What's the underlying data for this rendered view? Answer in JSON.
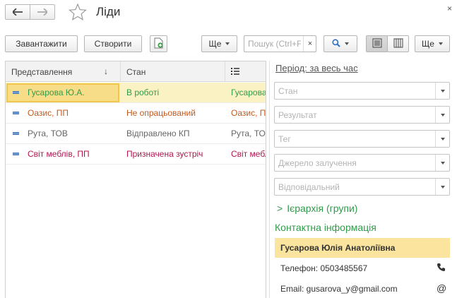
{
  "window": {
    "title": "Ліди",
    "close_glyph": "×"
  },
  "toolbar": {
    "load_label": "Завантажити",
    "create_label": "Створити",
    "more_label": "Ще",
    "search_placeholder": "Пошук (Ctrl+F)",
    "clear_glyph": "×",
    "more2_label": "Ще"
  },
  "table": {
    "columns": [
      "Представлення",
      "Стан",
      ""
    ],
    "sort_glyph": "↓",
    "rows": [
      {
        "name": "Гусарова Ю.А.",
        "state": "В роботі",
        "extra": "Гусарова Юлія Анатоліївна",
        "color": "#2f9b4a",
        "selected": true
      },
      {
        "name": "Оазис, ПП",
        "state": "Не опрацьований",
        "extra": "Оазис, ПП",
        "color": "#c45a1e",
        "selected": false
      },
      {
        "name": "Рута, ТОВ",
        "state": "Відправлено КП",
        "extra": "Рута, ТОВ",
        "color": "#666666",
        "selected": false
      },
      {
        "name": "Світ меблів, ПП",
        "state": "Призначена зустріч",
        "extra": "Світ меблів, ПП",
        "color": "#b3174f",
        "selected": false
      }
    ]
  },
  "filters": {
    "period_label": "Період: за весь час",
    "fields": [
      "Стан",
      "Результат",
      "Тег",
      "Джерело залучення",
      "Відповідальний"
    ]
  },
  "hierarchy": {
    "chevron": ">",
    "label": "Ієрархія (групи)"
  },
  "contact": {
    "title": "Контактна інформація",
    "name": "Гусарова Юлія Анатоліївна",
    "phone_line": "Телефон: 0503485567",
    "email_line": "Email: gusarova_y@gmail.com",
    "email_glyph": "@"
  },
  "colors": {
    "accent_green": "#2f9b4a",
    "selection": "#fbf2c4",
    "focus": "#f7dd87"
  }
}
